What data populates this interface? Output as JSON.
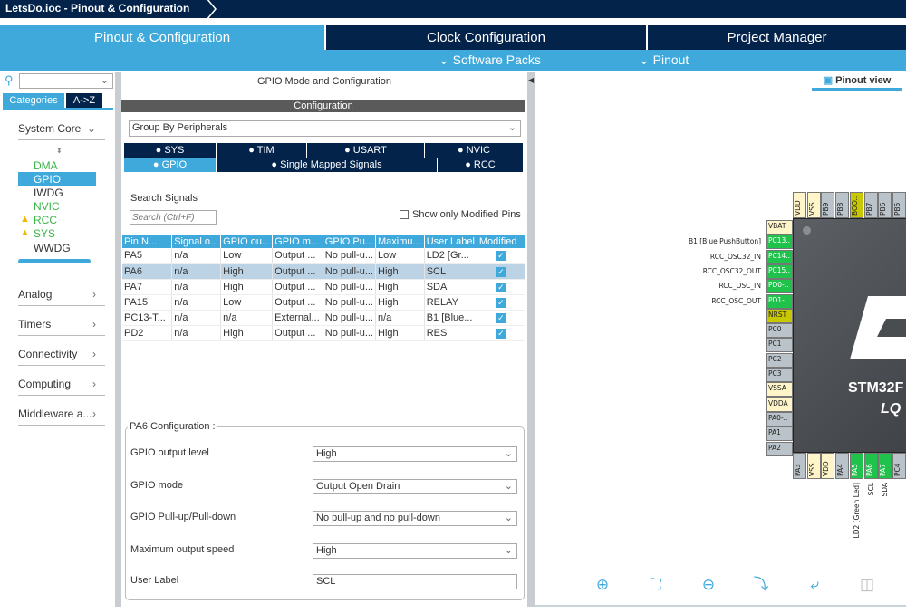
{
  "window": {
    "title": "LetsDo.ioc - Pinout & Configuration"
  },
  "main_tabs": [
    {
      "label": "Pinout & Configuration"
    },
    {
      "label": "Clock Configuration"
    },
    {
      "label": "Project Manager"
    }
  ],
  "subbar": {
    "software_packs": "Software Packs",
    "pinout": "Pinout"
  },
  "left": {
    "search_value": "",
    "tabs": {
      "categories": "Categories",
      "az": "A->Z"
    },
    "system_core": "System Core",
    "items": [
      {
        "label": "DMA",
        "state": "configured"
      },
      {
        "label": "GPIO",
        "state": "selected"
      },
      {
        "label": "IWDG",
        "state": "normal"
      },
      {
        "label": "NVIC",
        "state": "configured"
      },
      {
        "label": "RCC",
        "state": "warning"
      },
      {
        "label": "SYS",
        "state": "warning"
      },
      {
        "label": "WWDG",
        "state": "normal"
      }
    ],
    "categories": [
      "Analog",
      "Timers",
      "Connectivity",
      "Computing",
      "Middleware a..."
    ]
  },
  "middle": {
    "header": "GPIO Mode and Configuration",
    "config_bar": "Configuration",
    "group_by": "Group By Peripherals",
    "tabs_row1": [
      "SYS",
      "TIM",
      "USART",
      "NVIC"
    ],
    "tabs_row2": [
      "GPIO",
      "Single Mapped Signals",
      "RCC"
    ],
    "search_label": "Search Signals",
    "search_placeholder": "Search (Ctrl+F)",
    "show_modified": "Show only Modified Pins",
    "table": {
      "headers": [
        "Pin N...",
        "Signal o...",
        "GPIO ou...",
        "GPIO m...",
        "GPIO Pu...",
        "Maximu...",
        "User Label",
        "Modified"
      ],
      "rows": [
        [
          "PA5",
          "n/a",
          "Low",
          "Output ...",
          "No pull-u...",
          "Low",
          "LD2 [Gr...",
          true
        ],
        [
          "PA6",
          "n/a",
          "High",
          "Output ...",
          "No pull-u...",
          "High",
          "SCL",
          true
        ],
        [
          "PA7",
          "n/a",
          "High",
          "Output ...",
          "No pull-u...",
          "High",
          "SDA",
          true
        ],
        [
          "PA15",
          "n/a",
          "Low",
          "Output ...",
          "No pull-u...",
          "High",
          "RELAY",
          true
        ],
        [
          "PC13-T...",
          "n/a",
          "n/a",
          "External...",
          "No pull-u...",
          "n/a",
          "B1 [Blue...",
          true
        ],
        [
          "PD2",
          "n/a",
          "High",
          "Output ...",
          "No pull-u...",
          "High",
          "RES",
          true
        ]
      ],
      "selected_row": 1
    },
    "pa6": {
      "title": "PA6 Configuration :",
      "fields": [
        {
          "label": "GPIO output level",
          "value": "High"
        },
        {
          "label": "GPIO mode",
          "value": "Output Open Drain"
        },
        {
          "label": "GPIO Pull-up/Pull-down",
          "value": "No pull-up and no pull-down"
        },
        {
          "label": "Maximum output speed",
          "value": "High"
        },
        {
          "label": "User Label",
          "value": "SCL"
        }
      ]
    }
  },
  "right": {
    "pinout_view": "Pinout view",
    "chip": {
      "name": "STM32F",
      "package": "LQ"
    },
    "top_pins": [
      {
        "n": "VDD",
        "t": "power"
      },
      {
        "n": "VSS",
        "t": "power"
      },
      {
        "n": "PB9",
        "t": "io"
      },
      {
        "n": "PB8",
        "t": "io"
      },
      {
        "n": "BOO..",
        "t": "boot"
      },
      {
        "n": "PB7",
        "t": "io"
      },
      {
        "n": "PB6",
        "t": "io"
      },
      {
        "n": "PB5",
        "t": "io"
      }
    ],
    "left_pins": [
      {
        "n": "VBAT",
        "t": "power"
      },
      {
        "n": "PC13..",
        "t": "used",
        "l": "B1 [Blue PushButton]"
      },
      {
        "n": "PC14..",
        "t": "used",
        "l": "RCC_OSC32_IN"
      },
      {
        "n": "PC15..",
        "t": "used",
        "l": "RCC_OSC32_OUT"
      },
      {
        "n": "PD0-..",
        "t": "used",
        "l": "RCC_OSC_IN"
      },
      {
        "n": "PD1-..",
        "t": "used",
        "l": "RCC_OSC_OUT"
      },
      {
        "n": "NRST",
        "t": "boot"
      },
      {
        "n": "PC0",
        "t": "io"
      },
      {
        "n": "PC1",
        "t": "io"
      },
      {
        "n": "PC2",
        "t": "io"
      },
      {
        "n": "PC3",
        "t": "io"
      },
      {
        "n": "VSSA",
        "t": "power"
      },
      {
        "n": "VDDA",
        "t": "power"
      },
      {
        "n": "PA0-..",
        "t": "io"
      },
      {
        "n": "PA1",
        "t": "io"
      },
      {
        "n": "PA2",
        "t": "io"
      }
    ],
    "bottom_pins": [
      {
        "n": "PA3",
        "t": "io"
      },
      {
        "n": "VSS",
        "t": "power"
      },
      {
        "n": "VDD",
        "t": "power"
      },
      {
        "n": "PA4",
        "t": "io"
      },
      {
        "n": "PA5",
        "t": "used",
        "l": "LD2 [Green Led]"
      },
      {
        "n": "PA6",
        "t": "used",
        "l": "SCL"
      },
      {
        "n": "PA7",
        "t": "used",
        "l": "SDA"
      },
      {
        "n": "PC4",
        "t": "io"
      }
    ],
    "pin_colors": {
      "power": "#fff5c8",
      "io": "#b9c3c9",
      "used": "#1fc24a",
      "boot": "#c8c800"
    },
    "toolbar": [
      "zoom-in",
      "fit",
      "zoom-out",
      "rotate-right",
      "rotate-left",
      "split"
    ]
  },
  "colors": {
    "navy": "#03234b",
    "accent": "#3fa9dc"
  }
}
